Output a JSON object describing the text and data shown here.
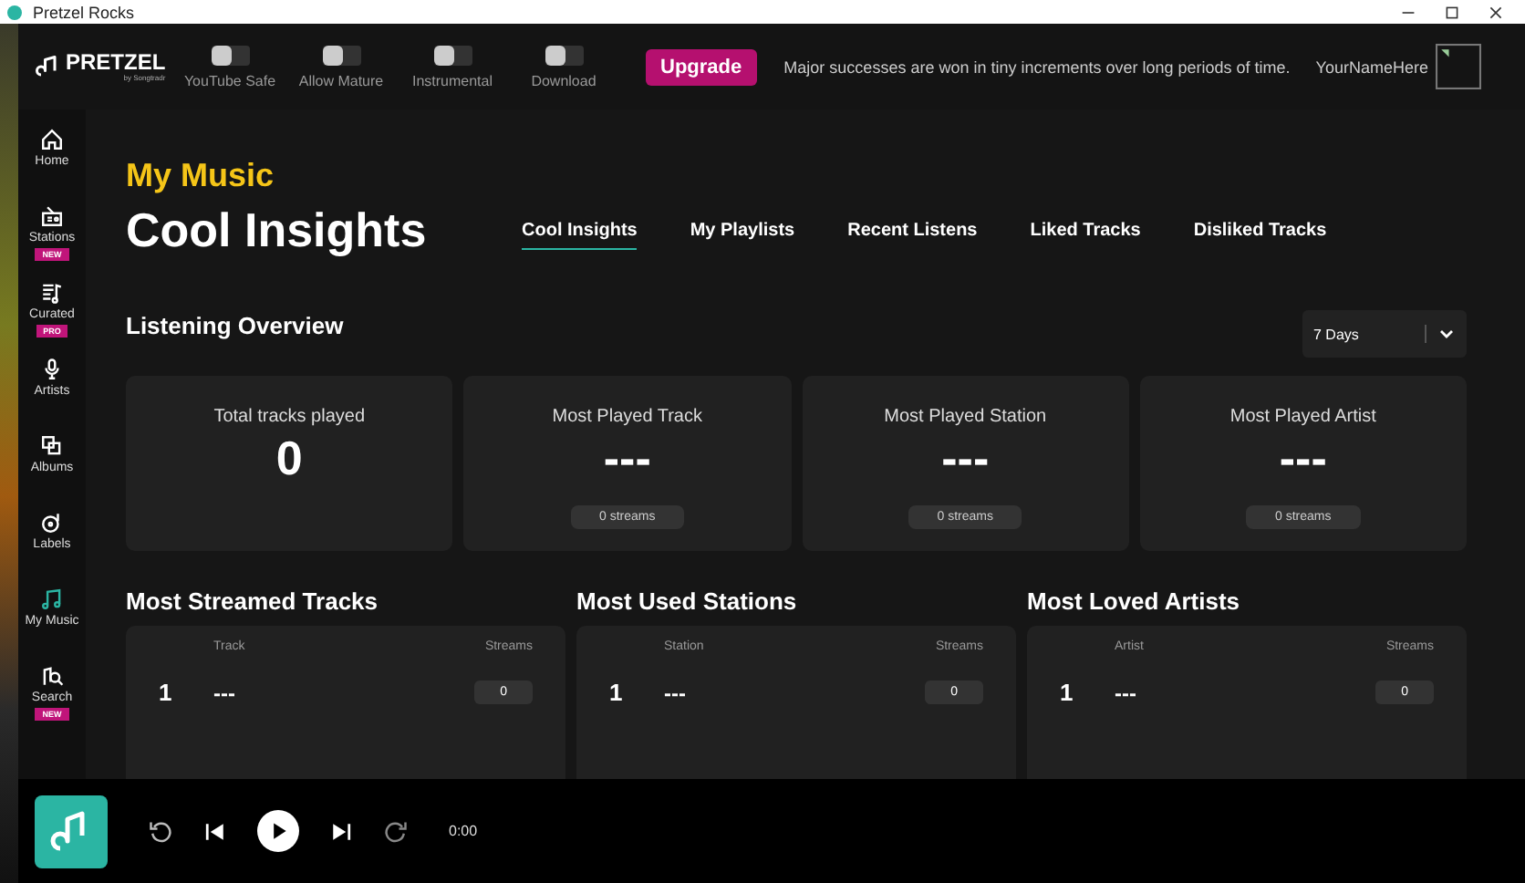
{
  "window": {
    "title": "Pretzel Rocks"
  },
  "header": {
    "logo": "PRETZEL",
    "logo_sub": "by Songtradr",
    "toggles": [
      {
        "label": "YouTube Safe",
        "on": false
      },
      {
        "label": "Allow Mature",
        "on": false
      },
      {
        "label": "Instrumental",
        "on": false
      },
      {
        "label": "Download",
        "on": false
      }
    ],
    "upgrade": "Upgrade",
    "quote": "Major successes are won in tiny increments over long periods of time.",
    "username": "YourNameHere"
  },
  "sidebar": {
    "items": [
      {
        "kind": "home",
        "label": "Home",
        "selected": false
      },
      {
        "kind": "stations",
        "label": "Stations",
        "badge": "NEW",
        "selected": false
      },
      {
        "kind": "curated",
        "label": "Curated",
        "badge": "PRO",
        "selected": false
      },
      {
        "kind": "artists",
        "label": "Artists",
        "selected": false
      },
      {
        "kind": "albums",
        "label": "Albums",
        "selected": false
      },
      {
        "kind": "labels",
        "label": "Labels",
        "selected": false
      },
      {
        "kind": "music",
        "label": "My Music",
        "selected": true
      },
      {
        "kind": "search",
        "label": "Search",
        "badge": "NEW",
        "selected": false
      }
    ]
  },
  "page": {
    "eyebrow": "My Music",
    "title": "Cool Insights",
    "tabs": [
      {
        "label": "Cool Insights",
        "selected": true
      },
      {
        "label": "My Playlists",
        "selected": false
      },
      {
        "label": "Recent Listens",
        "selected": false
      },
      {
        "label": "Liked Tracks",
        "selected": false
      },
      {
        "label": "Disliked Tracks",
        "selected": false
      }
    ]
  },
  "overview": {
    "title": "Listening Overview",
    "range": "7 Days",
    "cards": [
      {
        "title": "Total tracks played",
        "value": "0"
      },
      {
        "title": "Most Played Track",
        "value": "---",
        "streams": "0 streams"
      },
      {
        "title": "Most Played Station",
        "value": "---",
        "streams": "0 streams"
      },
      {
        "title": "Most Played Artist",
        "value": "---",
        "streams": "0 streams"
      }
    ]
  },
  "rankings": [
    {
      "title": "Most Streamed Tracks",
      "column_1": "Track",
      "column_2": "Streams",
      "rows": [
        {
          "rank": "1",
          "name": "---",
          "streams": "0"
        }
      ]
    },
    {
      "title": "Most Used Stations",
      "column_1": "Station",
      "column_2": "Streams",
      "rows": [
        {
          "rank": "1",
          "name": "---",
          "streams": "0"
        }
      ]
    },
    {
      "title": "Most Loved Artists",
      "column_1": "Artist",
      "column_2": "Streams",
      "rows": [
        {
          "rank": "1",
          "name": "---",
          "streams": "0"
        }
      ]
    }
  ],
  "player": {
    "time": "0:00"
  }
}
